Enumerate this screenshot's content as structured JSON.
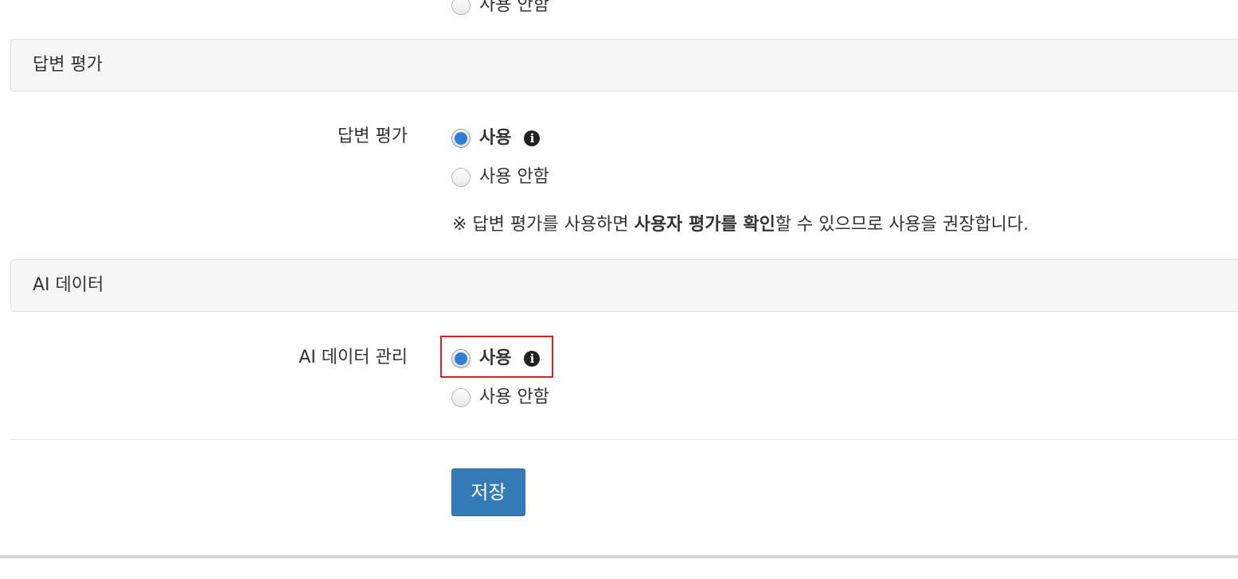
{
  "top_partial": {
    "disabled_label": "사용 안함"
  },
  "answer_eval": {
    "section_title": "답변 평가",
    "field_label": "답변 평가",
    "enabled_label": "사용",
    "disabled_label": "사용 안함",
    "selected": "enabled",
    "note_prefix": "※ 답변 평가를 사용하면 ",
    "note_bold": "사용자 평가를 확인",
    "note_suffix": "할 수 있으므로 사용을 권장합니다."
  },
  "ai_data": {
    "section_title": "AI 데이터",
    "field_label": "AI 데이터 관리",
    "enabled_label": "사용",
    "disabled_label": "사용 안함",
    "selected": "enabled"
  },
  "info_icon_glyph": "i",
  "save_label": "저장",
  "colors": {
    "radio_selected": "#2f7fd6",
    "save_button": "#337ab7",
    "highlight": "#e02020",
    "section_bg": "#f6f6f7"
  }
}
